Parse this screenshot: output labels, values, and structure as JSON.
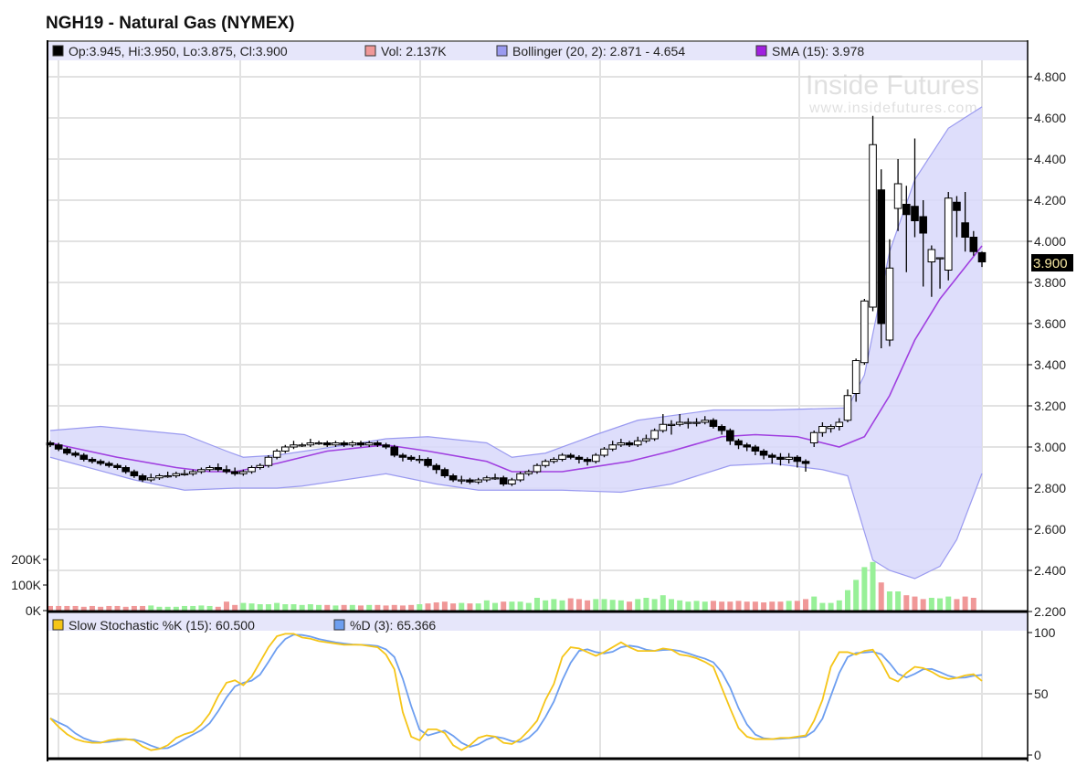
{
  "title": "NGH19 - Natural Gas (NYMEX)",
  "watermark": {
    "brand": "Inside Futures",
    "url": "www.insidefutures.com"
  },
  "colors": {
    "up_volume": "#98f098",
    "down_volume": "#f09898",
    "band_fill": "#d8d8fa",
    "band_line": "#9a9af0",
    "sma": "#a040e0",
    "k_line": "#f5c518",
    "d_line": "#6d9ef0",
    "legend_bg": "#e6e6fa"
  },
  "legend": {
    "ohlc": "Op:3.945, Hi:3.950, Lo:3.875, Cl:3.900",
    "volume": "Vol: 2.137K",
    "bollinger": "Bollinger (20, 2): 2.871 - 4.654",
    "sma": "SMA (15): 3.978",
    "stoch_k": "Slow Stochastic %K (15): 60.500",
    "stoch_d": "%D (3): 65.366"
  },
  "last_price_label": "3.900",
  "chart_data": {
    "type": "candlestick",
    "title": "NGH19 - Natural Gas (NYMEX)",
    "price_axis": {
      "ylim": [
        2.2,
        4.9
      ],
      "ticks": [
        "2.200",
        "2.400",
        "2.600",
        "2.800",
        "3.000",
        "3.200",
        "3.400",
        "3.600",
        "3.800",
        "4.000",
        "4.200",
        "4.400",
        "4.600",
        "4.800"
      ]
    },
    "volume_axis": {
      "ylim": [
        0,
        200
      ],
      "unit": "K",
      "ticks": [
        "0K",
        "100K",
        "200K"
      ]
    },
    "stoch_axis": {
      "ylim": [
        0,
        100
      ],
      "ticks": [
        "0",
        "50",
        "100"
      ]
    },
    "close": [
      3.01,
      2.99,
      2.97,
      2.96,
      2.94,
      2.93,
      2.92,
      2.91,
      2.9,
      2.88,
      2.86,
      2.84,
      2.85,
      2.86,
      2.86,
      2.87,
      2.87,
      2.88,
      2.89,
      2.9,
      2.89,
      2.88,
      2.87,
      2.88,
      2.9,
      2.91,
      2.95,
      2.98,
      3.0,
      3.01,
      3.01,
      3.02,
      3.02,
      3.01,
      3.02,
      3.01,
      3.02,
      3.01,
      3.02,
      3.01,
      3.0,
      2.96,
      2.95,
      2.94,
      2.94,
      2.91,
      2.89,
      2.86,
      2.84,
      2.84,
      2.83,
      2.84,
      2.85,
      2.85,
      2.82,
      2.84,
      2.87,
      2.88,
      2.91,
      2.93,
      2.94,
      2.96,
      2.95,
      2.94,
      2.93,
      2.96,
      2.99,
      3.01,
      3.02,
      3.01,
      3.03,
      3.04,
      3.08,
      3.11,
      3.11,
      3.12,
      3.12,
      3.12,
      3.13,
      3.1,
      3.08,
      3.03,
      3.01,
      3.0,
      2.98,
      2.96,
      2.95,
      2.94,
      2.95,
      2.93,
      2.92,
      3.07,
      3.1,
      3.1,
      3.12,
      3.25,
      3.42,
      3.71,
      4.47,
      3.6,
      3.87,
      4.28,
      4.13,
      4.1,
      4.04,
      3.96,
      3.92,
      4.21,
      4.15,
      4.02,
      3.95,
      3.9
    ],
    "open": [
      3.02,
      3.01,
      2.99,
      2.97,
      2.96,
      2.94,
      2.93,
      2.92,
      2.91,
      2.9,
      2.88,
      2.86,
      2.84,
      2.85,
      2.86,
      2.86,
      2.87,
      2.87,
      2.88,
      2.89,
      2.9,
      2.89,
      2.88,
      2.87,
      2.88,
      2.9,
      2.91,
      2.95,
      2.98,
      3.0,
      3.01,
      3.01,
      3.02,
      3.02,
      3.01,
      3.02,
      3.01,
      3.02,
      3.01,
      3.02,
      3.01,
      3.0,
      2.96,
      2.95,
      2.94,
      2.94,
      2.91,
      2.89,
      2.86,
      2.84,
      2.84,
      2.83,
      2.84,
      2.85,
      2.85,
      2.82,
      2.84,
      2.87,
      2.88,
      2.91,
      2.93,
      2.94,
      2.96,
      2.95,
      2.94,
      2.93,
      2.96,
      2.99,
      3.01,
      3.02,
      3.01,
      3.03,
      3.04,
      3.08,
      3.11,
      3.11,
      3.12,
      3.12,
      3.12,
      3.13,
      3.1,
      3.08,
      3.03,
      3.01,
      3.0,
      2.98,
      2.96,
      2.95,
      2.94,
      2.95,
      2.93,
      3.02,
      3.07,
      3.09,
      3.1,
      3.13,
      3.26,
      3.41,
      3.68,
      4.25,
      3.52,
      4.16,
      4.18,
      4.17,
      4.12,
      3.9,
      3.92,
      3.86,
      4.19,
      4.09,
      4.02,
      3.945
    ],
    "high": [
      3.03,
      3.02,
      3.0,
      2.98,
      2.97,
      2.95,
      2.94,
      2.93,
      2.92,
      2.91,
      2.89,
      2.87,
      2.87,
      2.87,
      2.88,
      2.88,
      2.89,
      2.89,
      2.9,
      2.91,
      2.92,
      2.91,
      2.9,
      2.89,
      2.91,
      2.92,
      2.96,
      2.99,
      3.01,
      3.03,
      3.02,
      3.04,
      3.03,
      3.03,
      3.03,
      3.03,
      3.03,
      3.03,
      3.03,
      3.03,
      3.02,
      3.01,
      2.97,
      2.96,
      2.96,
      2.95,
      2.92,
      2.9,
      2.87,
      2.86,
      2.85,
      2.85,
      2.86,
      2.87,
      2.86,
      2.85,
      2.88,
      2.89,
      2.92,
      2.94,
      2.95,
      2.97,
      2.97,
      2.96,
      2.95,
      2.97,
      3.0,
      3.03,
      3.04,
      3.03,
      3.05,
      3.06,
      3.09,
      3.16,
      3.13,
      3.16,
      3.14,
      3.14,
      3.15,
      3.14,
      3.11,
      3.09,
      3.04,
      3.02,
      3.01,
      2.99,
      2.97,
      2.97,
      2.97,
      2.96,
      2.94,
      3.08,
      3.12,
      3.11,
      3.14,
      3.28,
      3.43,
      3.72,
      4.61,
      4.35,
      4.01,
      4.4,
      4.27,
      4.5,
      4.2,
      3.98,
      3.92,
      4.24,
      4.22,
      4.24,
      4.05,
      3.95
    ],
    "low": [
      3.0,
      2.98,
      2.96,
      2.95,
      2.93,
      2.92,
      2.91,
      2.9,
      2.89,
      2.87,
      2.85,
      2.83,
      2.83,
      2.84,
      2.85,
      2.85,
      2.86,
      2.86,
      2.87,
      2.88,
      2.88,
      2.87,
      2.86,
      2.86,
      2.87,
      2.89,
      2.9,
      2.94,
      2.97,
      2.99,
      3.0,
      3.0,
      3.01,
      3.0,
      3.0,
      3.0,
      3.0,
      3.0,
      3.0,
      3.0,
      2.99,
      2.95,
      2.93,
      2.93,
      2.92,
      2.9,
      2.87,
      2.85,
      2.83,
      2.82,
      2.82,
      2.82,
      2.83,
      2.84,
      2.81,
      2.81,
      2.83,
      2.86,
      2.87,
      2.9,
      2.92,
      2.93,
      2.94,
      2.92,
      2.91,
      2.92,
      2.95,
      2.98,
      3.0,
      3.0,
      3.0,
      3.02,
      3.03,
      3.07,
      3.06,
      3.1,
      3.09,
      3.1,
      3.11,
      3.09,
      3.06,
      3.01,
      2.99,
      2.98,
      2.96,
      2.94,
      2.92,
      2.91,
      2.92,
      2.9,
      2.88,
      3.0,
      3.05,
      3.07,
      3.08,
      3.12,
      3.22,
      3.4,
      3.66,
      3.48,
      3.49,
      4.05,
      3.85,
      4.02,
      3.78,
      3.73,
      3.77,
      3.81,
      4.02,
      3.95,
      3.93,
      3.875
    ],
    "volume": [
      18,
      18,
      18,
      18,
      15,
      18,
      15,
      18,
      18,
      15,
      18,
      18,
      20,
      15,
      15,
      15,
      18,
      18,
      20,
      18,
      15,
      35,
      22,
      30,
      28,
      25,
      25,
      30,
      25,
      25,
      22,
      25,
      22,
      22,
      20,
      22,
      22,
      20,
      22,
      22,
      20,
      22,
      20,
      22,
      25,
      28,
      32,
      35,
      28,
      30,
      28,
      28,
      40,
      30,
      35,
      35,
      35,
      30,
      50,
      40,
      45,
      40,
      48,
      45,
      40,
      45,
      45,
      42,
      40,
      35,
      45,
      50,
      45,
      60,
      45,
      40,
      35,
      38,
      35,
      38,
      35,
      35,
      38,
      35,
      35,
      32,
      35,
      35,
      38,
      38,
      45,
      55,
      30,
      30,
      40,
      80,
      120,
      170,
      190,
      110,
      75,
      75,
      60,
      55,
      45,
      50,
      48,
      55,
      45,
      55,
      50,
      2.137
    ],
    "bollinger_upper": [
      [
        0,
        3.08
      ],
      [
        6,
        3.1
      ],
      [
        16,
        3.06
      ],
      [
        21,
        2.98
      ],
      [
        23,
        2.95
      ],
      [
        27,
        2.96
      ],
      [
        37,
        3.02
      ],
      [
        40,
        3.04
      ],
      [
        45,
        3.05
      ],
      [
        52,
        3.02
      ],
      [
        55,
        2.95
      ],
      [
        59,
        2.97
      ],
      [
        65,
        3.06
      ],
      [
        70,
        3.13
      ],
      [
        79,
        3.18
      ],
      [
        86,
        3.18
      ],
      [
        95,
        3.19
      ],
      [
        97,
        3.35
      ],
      [
        100,
        3.95
      ],
      [
        103,
        4.3
      ],
      [
        107,
        4.55
      ],
      [
        111,
        4.654
      ]
    ],
    "bollinger_lower": [
      [
        0,
        2.95
      ],
      [
        10,
        2.84
      ],
      [
        16,
        2.79
      ],
      [
        22,
        2.8
      ],
      [
        27,
        2.8
      ],
      [
        30,
        2.81
      ],
      [
        40,
        2.87
      ],
      [
        46,
        2.82
      ],
      [
        51,
        2.79
      ],
      [
        55,
        2.79
      ],
      [
        61,
        2.79
      ],
      [
        68,
        2.78
      ],
      [
        74,
        2.82
      ],
      [
        81,
        2.91
      ],
      [
        86,
        2.92
      ],
      [
        92,
        2.89
      ],
      [
        95,
        2.86
      ],
      [
        98,
        2.45
      ],
      [
        100,
        2.4
      ],
      [
        103,
        2.36
      ],
      [
        106,
        2.42
      ],
      [
        108,
        2.55
      ],
      [
        111,
        2.871
      ]
    ],
    "sma": [
      [
        0,
        3.02
      ],
      [
        8,
        2.95
      ],
      [
        15,
        2.9
      ],
      [
        19,
        2.88
      ],
      [
        22,
        2.88
      ],
      [
        27,
        2.92
      ],
      [
        33,
        2.98
      ],
      [
        40,
        3.01
      ],
      [
        45,
        2.98
      ],
      [
        52,
        2.93
      ],
      [
        55,
        2.88
      ],
      [
        61,
        2.88
      ],
      [
        69,
        2.93
      ],
      [
        74,
        2.98
      ],
      [
        80,
        3.05
      ],
      [
        84,
        3.06
      ],
      [
        89,
        3.05
      ],
      [
        94,
        3.0
      ],
      [
        97,
        3.05
      ],
      [
        100,
        3.25
      ],
      [
        103,
        3.52
      ],
      [
        106,
        3.72
      ],
      [
        111,
        3.978
      ]
    ],
    "stoch_k": [
      30,
      23,
      17,
      13,
      11,
      10,
      10,
      12,
      13,
      13,
      12,
      7,
      4,
      5,
      8,
      14,
      17,
      19,
      25,
      34,
      48,
      59,
      61,
      57,
      64,
      76,
      88,
      97,
      99,
      99,
      96,
      95,
      93,
      92,
      91,
      90,
      90,
      90,
      89,
      88,
      82,
      70,
      35,
      15,
      12,
      21,
      21,
      18,
      8,
      4,
      8,
      14,
      16,
      15,
      10,
      9,
      13,
      20,
      28,
      45,
      58,
      80,
      88,
      87,
      84,
      81,
      84,
      88,
      92,
      88,
      85,
      85,
      85,
      87,
      86,
      82,
      81,
      79,
      76,
      72,
      55,
      38,
      22,
      15,
      13,
      13,
      13,
      14,
      14,
      15,
      16,
      28,
      45,
      72,
      84,
      84,
      82,
      85,
      86,
      76,
      63,
      60,
      67,
      72,
      71,
      68,
      64,
      62,
      63,
      65,
      66,
      60.5
    ],
    "stoch_d": [
      30,
      26.5,
      23.3,
      17.7,
      13.7,
      11.3,
      10.3,
      10.7,
      11.7,
      12.7,
      12.7,
      10.7,
      7.7,
      5.3,
      5.7,
      9,
      13,
      16.7,
      20.3,
      26,
      35.7,
      47,
      56,
      59,
      60.7,
      65.7,
      76,
      87,
      94.7,
      98.3,
      98,
      96.7,
      94.7,
      93.3,
      92,
      91,
      90.3,
      90,
      89.7,
      89,
      86.3,
      80,
      62.3,
      40,
      20.7,
      16,
      18,
      20,
      15.7,
      10,
      6.7,
      8.7,
      12.7,
      15,
      13.7,
      11.3,
      10.7,
      14,
      20.3,
      31,
      43.7,
      61,
      75.3,
      85,
      86.3,
      84,
      83,
      84.3,
      88,
      89.3,
      88.3,
      86,
      85,
      85.7,
      86,
      85,
      83,
      80.7,
      78.7,
      75.7,
      67.7,
      55,
      38.3,
      25,
      16.7,
      13.7,
      13,
      13.3,
      13.7,
      14.3,
      15,
      19.7,
      29.7,
      48.3,
      67,
      80,
      83.3,
      83.7,
      84.3,
      82.3,
      75,
      66.3,
      63.3,
      66.3,
      70,
      70.3,
      67.7,
      64.7,
      63,
      63.3,
      64.7,
      65.366
    ]
  }
}
